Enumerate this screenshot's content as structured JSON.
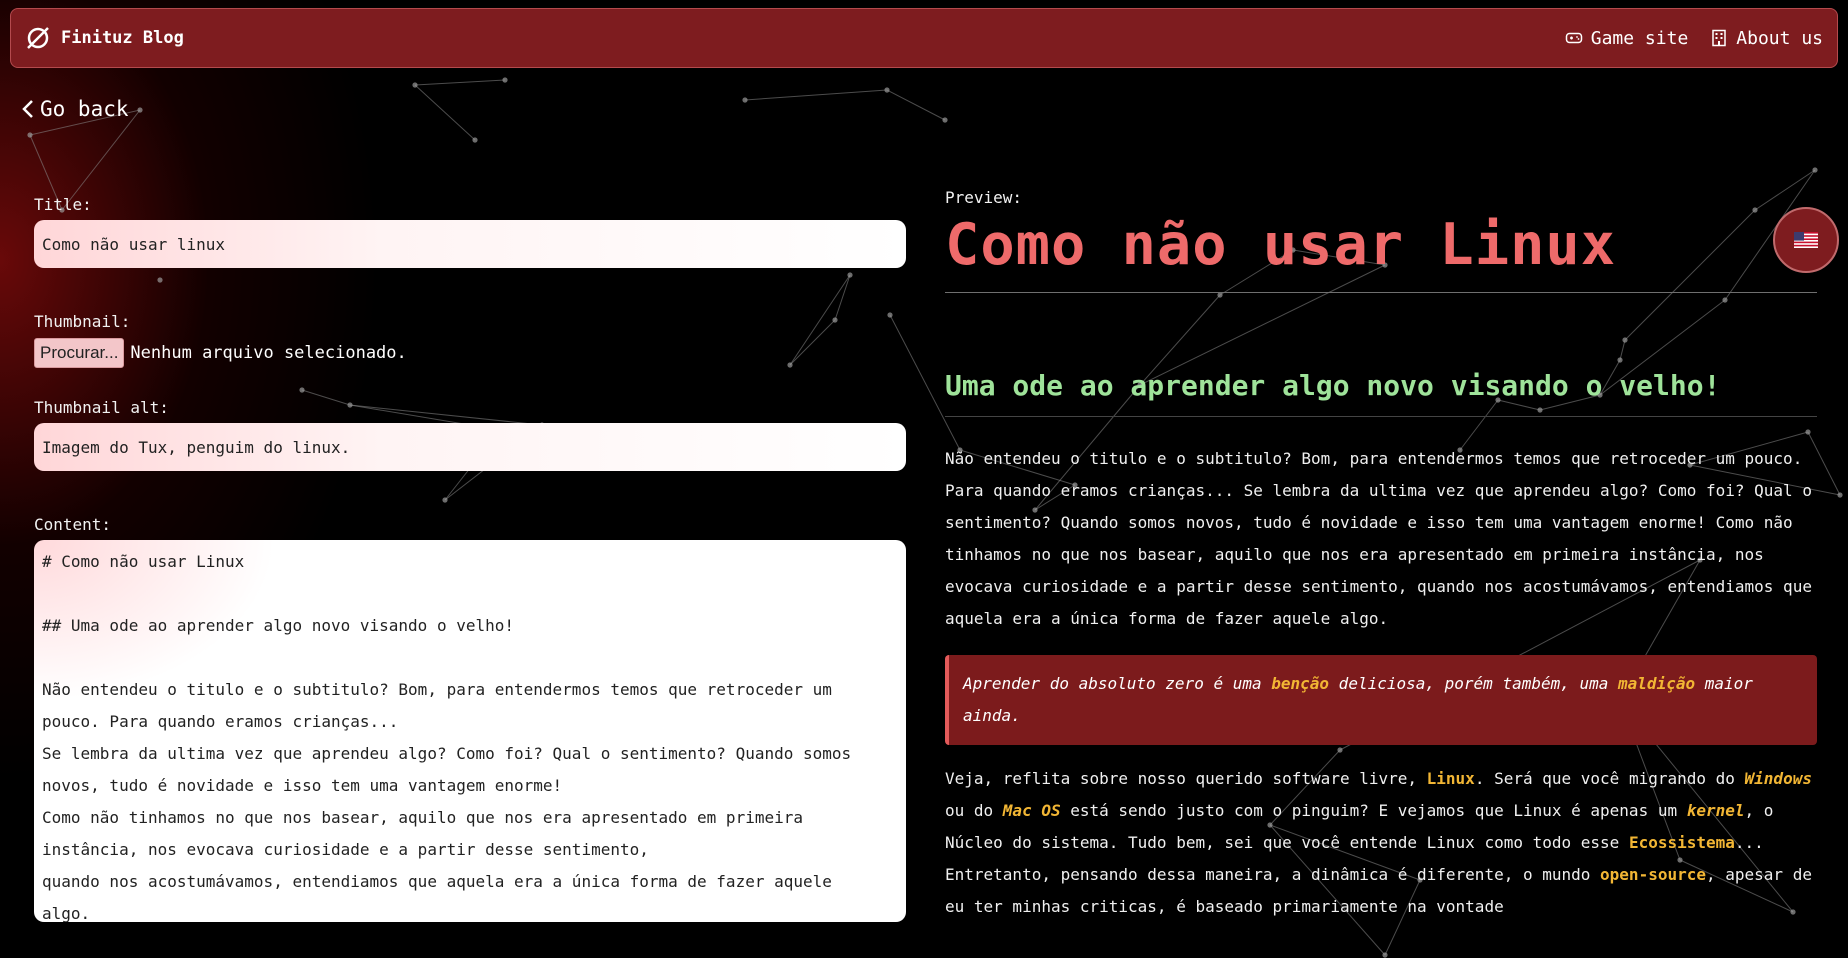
{
  "header": {
    "brand": "Finituz Blog",
    "nav": [
      {
        "label": "Game site",
        "icon": "gamepad-icon"
      },
      {
        "label": "About us",
        "icon": "building-icon"
      }
    ]
  },
  "back": {
    "label": "Go back"
  },
  "form": {
    "title_label": "Title:",
    "title_value": "Como não usar linux",
    "thumbnail_label": "Thumbnail:",
    "file_button": "Procurar...",
    "file_status": "Nenhum arquivo selecionado.",
    "thumb_alt_label": "Thumbnail alt:",
    "thumb_alt_value": "Imagem do Tux, penguim do linux.",
    "content_label": "Content:",
    "content_lines": [
      "# Como não usar Linux",
      "",
      "## Uma ode ao aprender algo novo visando o velho!",
      "",
      "Não entendeu o titulo e o subtitulo? Bom, para entendermos temos que retroceder um",
      "pouco. Para quando eramos crianças...",
      "Se lembra da ultima vez que aprendeu algo? Como foi? Qual o sentimento? Quando somos",
      "novos, tudo é novidade e isso tem uma vantagem enorme!",
      "Como não tinhamos no que nos basear, aquilo que nos era apresentado em primeira",
      "instância, nos evocava curiosidade e a partir desse sentimento,",
      "quando nos acostumávamos, entendiamos que aquela era a única forma de fazer aquele",
      "algo."
    ]
  },
  "preview": {
    "label": "Preview:",
    "title": "Como não usar Linux",
    "subtitle": "Uma ode ao aprender algo novo visando o velho!",
    "paragraph1": "Não entendeu o titulo e o subtitulo? Bom, para entendermos temos que retroceder um pouco. Para quando eramos crianças... Se lembra da ultima vez que aprendeu algo? Como foi? Qual o sentimento? Quando somos novos, tudo é novidade e isso tem uma vantagem enorme! Como não tinhamos no que nos basear, aquilo que nos era apresentado em primeira instância, nos evocava curiosidade e a partir desse sentimento, quando nos acostumávamos, entendiamos que aquela era a única forma de fazer aquele algo.",
    "quote": {
      "t1": "Aprender do absoluto zero é uma ",
      "h1": "benção",
      "t2": " deliciosa, porém também, uma ",
      "h2": "maldição",
      "t3": " maior ainda."
    },
    "p2": {
      "t1": "Veja, reflita sobre nosso querido software livre, ",
      "h1": "Linux",
      "t2": ". Será que você migrando do ",
      "h2": "Windows",
      "t3": " ou do ",
      "h3": "Mac OS",
      "t4": " está sendo justo com o pinguim? E vejamos que Linux é apenas um ",
      "h4": "kernel",
      "t5": ", o Núcleo do sistema. Tudo bem, sei que você entende Linux como todo esse ",
      "h5": "Ecossistema",
      "t6": "... Entretanto, pensando dessa maneira, a dinâmica é diferente, o mundo ",
      "h6": "open-source",
      "t7": ", apesar de eu ter minhas criticas, é baseado primariamente na vontade"
    }
  },
  "language": {
    "icon": "us-flag-icon"
  },
  "colors": {
    "header": "#7e1c1f",
    "accent": "#ee6a6a",
    "subtitle": "#9fe39a",
    "highlight": "#f2b634"
  }
}
